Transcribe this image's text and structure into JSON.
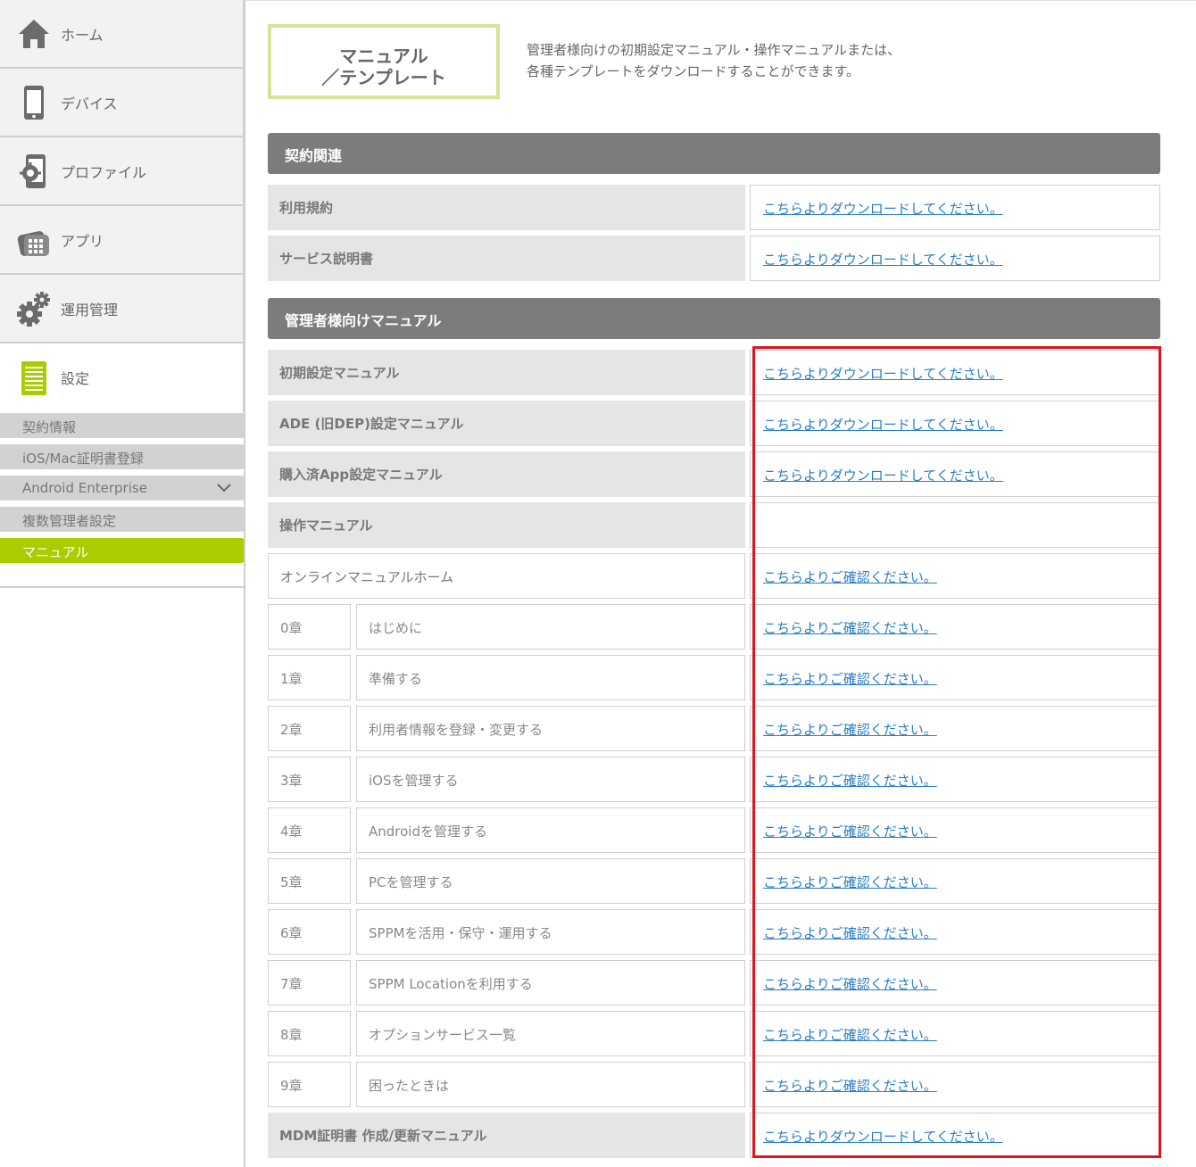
{
  "sidebar": {
    "nav": [
      {
        "label": "ホーム",
        "icon": "home-icon"
      },
      {
        "label": "デバイス",
        "icon": "device-icon"
      },
      {
        "label": "プロファイル",
        "icon": "profile-icon"
      },
      {
        "label": "アプリ",
        "icon": "app-icon"
      },
      {
        "label": "運用管理",
        "icon": "gear-icon"
      },
      {
        "label": "設定",
        "icon": "settings-document-icon"
      }
    ],
    "sub": [
      {
        "label": "契約情報"
      },
      {
        "label": "iOS/Mac証明書登録"
      },
      {
        "label": "Android Enterprise",
        "icon": "chevron-down-icon"
      },
      {
        "label": "複数管理者設定"
      },
      {
        "label": "マニュアル"
      }
    ]
  },
  "header": {
    "title_line1": "マニュアル",
    "title_line2": "／テンプレート",
    "desc_line1": "管理者様向けの初期設定マニュアル・操作マニュアルまたは、",
    "desc_line2": "各種テンプレートをダウンロードすることができます。"
  },
  "sections": {
    "contract": {
      "title": "契約関連",
      "rows": [
        {
          "label": "利用規約",
          "link": "こちらよりダウンロードしてください。"
        },
        {
          "label": "サービス説明書",
          "link": "こちらよりダウンロードしてください。"
        }
      ]
    },
    "admin": {
      "title": "管理者様向けマニュアル",
      "rows": [
        {
          "label": "初期設定マニュアル",
          "link": "こちらよりダウンロードしてください。"
        },
        {
          "label": "ADE (旧DEP)設定マニュアル",
          "link": "こちらよりダウンロードしてください。"
        },
        {
          "label": "購入済App設定マニュアル",
          "link": "こちらよりダウンロードしてください。"
        },
        {
          "label": "操作マニュアル",
          "link": ""
        },
        {
          "label": "オンラインマニュアルホーム",
          "link": "こちらよりご確認ください。"
        }
      ],
      "chapters": [
        {
          "ch": "0章",
          "title": "はじめに",
          "link": "こちらよりご確認ください。"
        },
        {
          "ch": "1章",
          "title": "準備する",
          "link": "こちらよりご確認ください。"
        },
        {
          "ch": "2章",
          "title": "利用者情報を登録・変更する",
          "link": "こちらよりご確認ください。"
        },
        {
          "ch": "3章",
          "title": "iOSを管理する",
          "link": "こちらよりご確認ください。"
        },
        {
          "ch": "4章",
          "title": "Androidを管理する",
          "link": "こちらよりご確認ください。"
        },
        {
          "ch": "5章",
          "title": "PCを管理する",
          "link": "こちらよりご確認ください。"
        },
        {
          "ch": "6章",
          "title": "SPPMを活用・保守・運用する",
          "link": "こちらよりご確認ください。"
        },
        {
          "ch": "7章",
          "title": "SPPM Locationを利用する",
          "link": "こちらよりご確認ください。"
        },
        {
          "ch": "8章",
          "title": "オプションサービス一覧",
          "link": "こちらよりご確認ください。"
        },
        {
          "ch": "9章",
          "title": "困ったときは",
          "link": "こちらよりご確認ください。"
        }
      ],
      "footer_row": {
        "label": "MDM証明書 作成/更新マニュアル",
        "link": "こちらよりダウンロードしてください。"
      }
    }
  },
  "colors": {
    "accent": "#aacc00",
    "highlight": "#e0141e",
    "link": "#2a7dc4",
    "section_bg": "#7c7c7c"
  }
}
